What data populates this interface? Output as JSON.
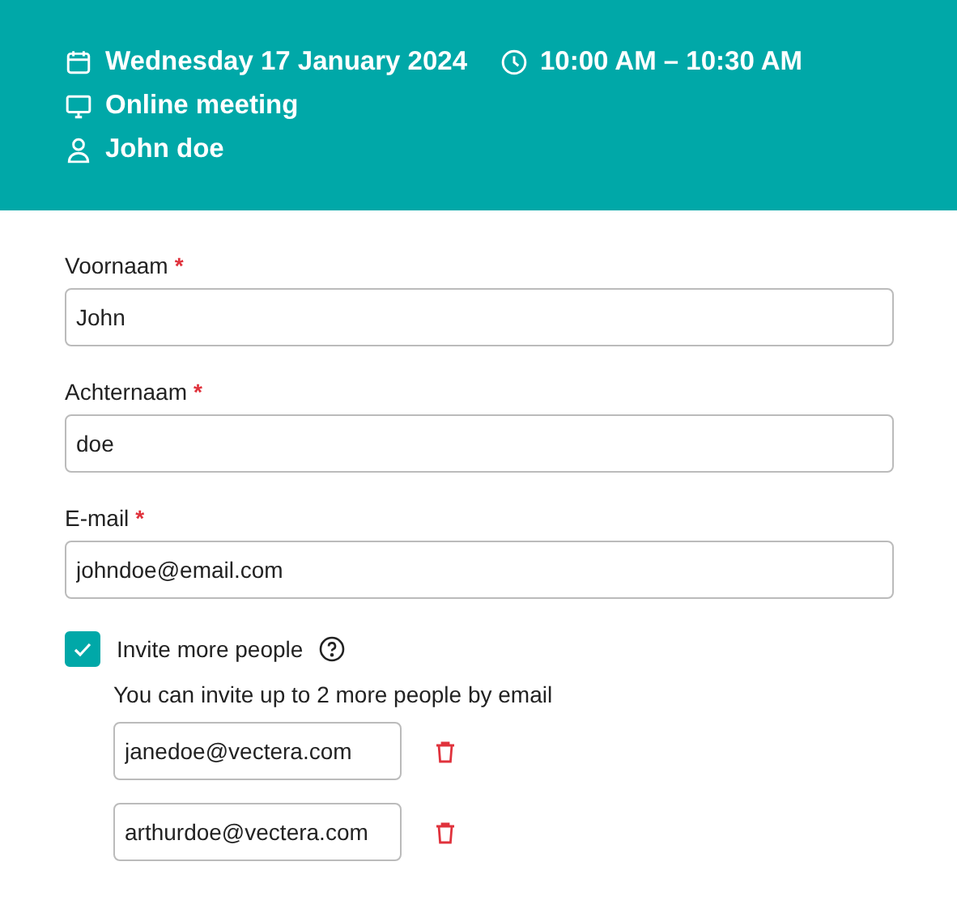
{
  "header": {
    "date": "Wednesday 17 January 2024",
    "time": "10:00 AM – 10:30 AM",
    "location": "Online meeting",
    "person": "John doe"
  },
  "fields": [
    {
      "label": "Voornaam",
      "required_mark": "*",
      "value": "John"
    },
    {
      "label": "Achternaam",
      "required_mark": "*",
      "value": "doe"
    },
    {
      "label": "E-mail",
      "required_mark": "*",
      "value": "johndoe@email.com"
    }
  ],
  "invite": {
    "label": "Invite more people",
    "checked": true,
    "hint": "You can invite up to 2 more people by email",
    "emails": [
      {
        "value": "janedoe@vectera.com"
      },
      {
        "value": "arthurdoe@vectera.com"
      }
    ]
  }
}
